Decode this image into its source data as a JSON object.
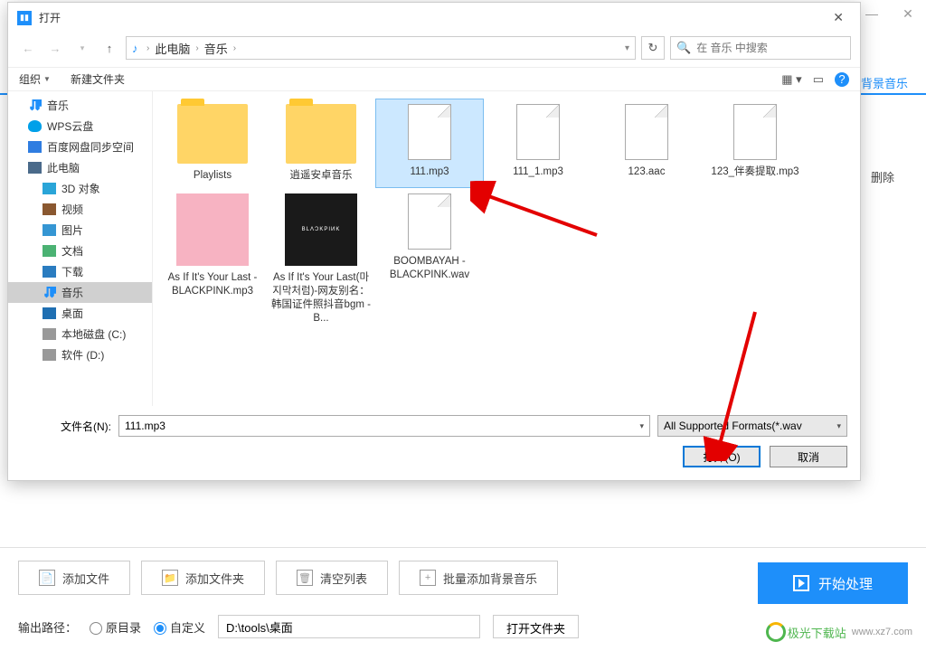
{
  "bg": {
    "tab_label": "背景音乐",
    "delete_label": "删除",
    "minimize": "—",
    "close": "✕",
    "add_file": "添加文件",
    "add_folder": "添加文件夹",
    "clear_list": "清空列表",
    "batch_add_bgm": "批量添加背景音乐",
    "start": "开始处理",
    "output_label": "输出路径：",
    "radio_orig": "原目录",
    "radio_custom": "自定义",
    "output_path": "D:\\tools\\桌面",
    "open_folder": "打开文件夹",
    "watermark_text": "极光下载站",
    "watermark_url": "www.xz7.com"
  },
  "dialog": {
    "title": "打开",
    "breadcrumb": {
      "pc": "此电脑",
      "music": "音乐"
    },
    "search_placeholder": "在 音乐 中搜索",
    "organize": "组织",
    "new_folder": "新建文件夹",
    "tree": {
      "music": "音乐",
      "wps": "WPS云盘",
      "baidu": "百度网盘同步空间",
      "this_pc": "此电脑",
      "obj3d": "3D 对象",
      "video": "视频",
      "pic": "图片",
      "doc": "文档",
      "download": "下载",
      "music2": "音乐",
      "desktop": "桌面",
      "diskc": "本地磁盘 (C:)",
      "diskd": "软件 (D:)"
    },
    "files": [
      {
        "name": "Playlists",
        "type": "folder"
      },
      {
        "name": "逍遥安卓音乐",
        "type": "folder"
      },
      {
        "name": "111.mp3",
        "type": "doc",
        "selected": true
      },
      {
        "name": "111_1.mp3",
        "type": "doc"
      },
      {
        "name": "123.aac",
        "type": "doc"
      },
      {
        "name": "123_伴奏提取.mp3",
        "type": "doc"
      },
      {
        "name": "As If It's Your Last - BLACKPINK.mp3",
        "type": "album-pink"
      },
      {
        "name": "As If It's Your Last(마지막처럼)-网友别名：韩国证件照抖音bgm - B...",
        "type": "album-black"
      },
      {
        "name": "BOOMBAYAH - BLACKPINK.wav",
        "type": "doc"
      }
    ],
    "filename_label": "文件名(N):",
    "filename_value": "111.mp3",
    "filter": "All Supported Formats(*.wav",
    "open_btn": "打开(O)",
    "cancel_btn": "取消"
  }
}
